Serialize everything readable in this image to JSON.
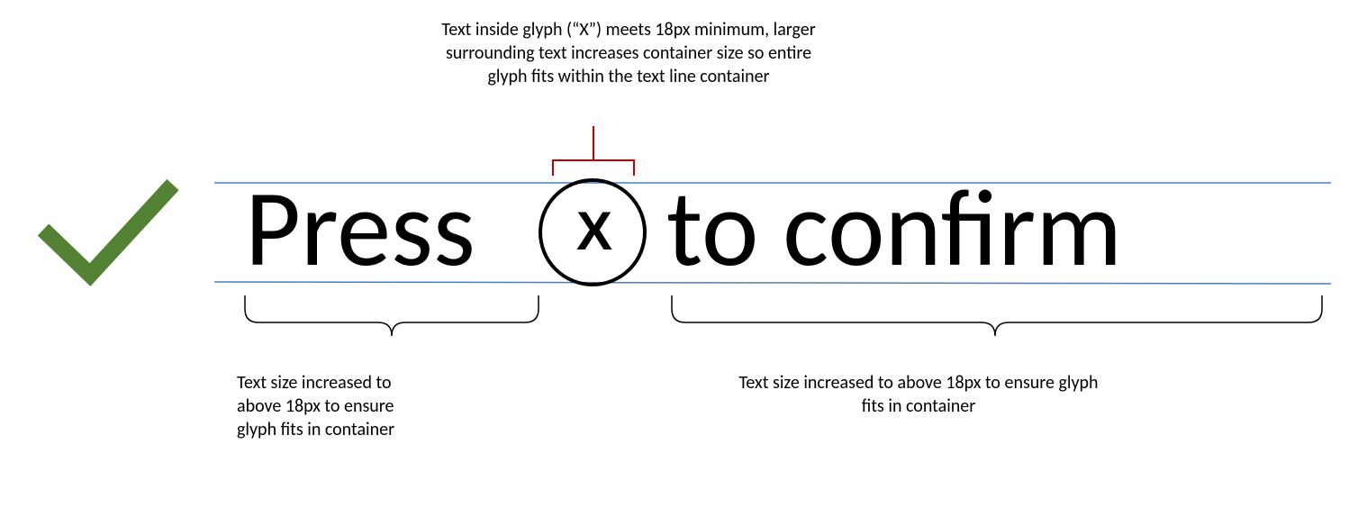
{
  "top_annotation": {
    "line1": "Text inside glyph (“X”) meets 18px minimum, larger",
    "line2": "surrounding text increases container size so entire",
    "line3": "glyph fits within the text line container"
  },
  "main": {
    "press": "Press",
    "glyph_letter": "X",
    "to_confirm": "to confirm"
  },
  "left_annotation": {
    "line1": "Text size increased to",
    "line2": "above 18px to ensure",
    "line3": "glyph fits in container"
  },
  "right_annotation": {
    "line1": "Text size increased to above 18px to ensure glyph",
    "line2": "fits in container"
  }
}
